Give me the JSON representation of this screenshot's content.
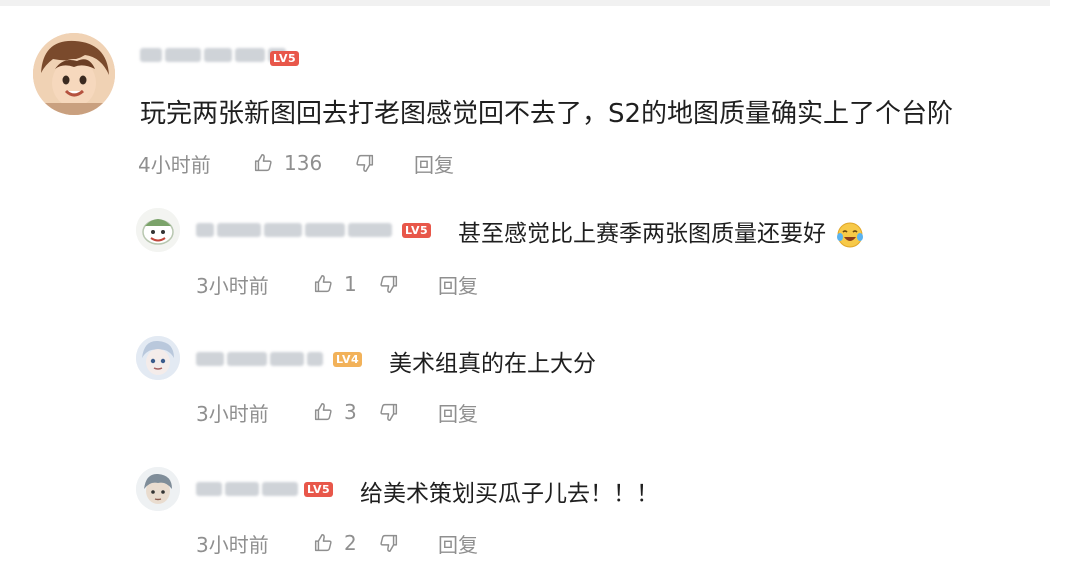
{
  "colors": {
    "badge_lv5": "#e8574a",
    "badge_lv4": "#f2b25a",
    "meta_gray": "#8f8f8f"
  },
  "comments": [
    {
      "badge": "LV5",
      "text": "玩完两张新图回去打老图感觉回不去了，S2的地图质量确实上了个台阶",
      "time": "4小时前",
      "likes": "136",
      "reply_label": "回复",
      "replies": [
        {
          "badge": "LV5",
          "text": "甚至感觉比上赛季两张图质量还要好",
          "emoji": "laughing-crying-emoji",
          "time": "3小时前",
          "likes": "1",
          "reply_label": "回复"
        },
        {
          "badge": "LV4",
          "text": "美术组真的在上大分",
          "time": "3小时前",
          "likes": "3",
          "reply_label": "回复"
        },
        {
          "badge": "LV5",
          "text": "给美术策划买瓜子儿去！！！",
          "time": "3小时前",
          "likes": "2",
          "reply_label": "回复"
        }
      ]
    }
  ],
  "icons": {
    "like": "thumbs-up-icon",
    "dislike": "thumbs-down-icon"
  }
}
